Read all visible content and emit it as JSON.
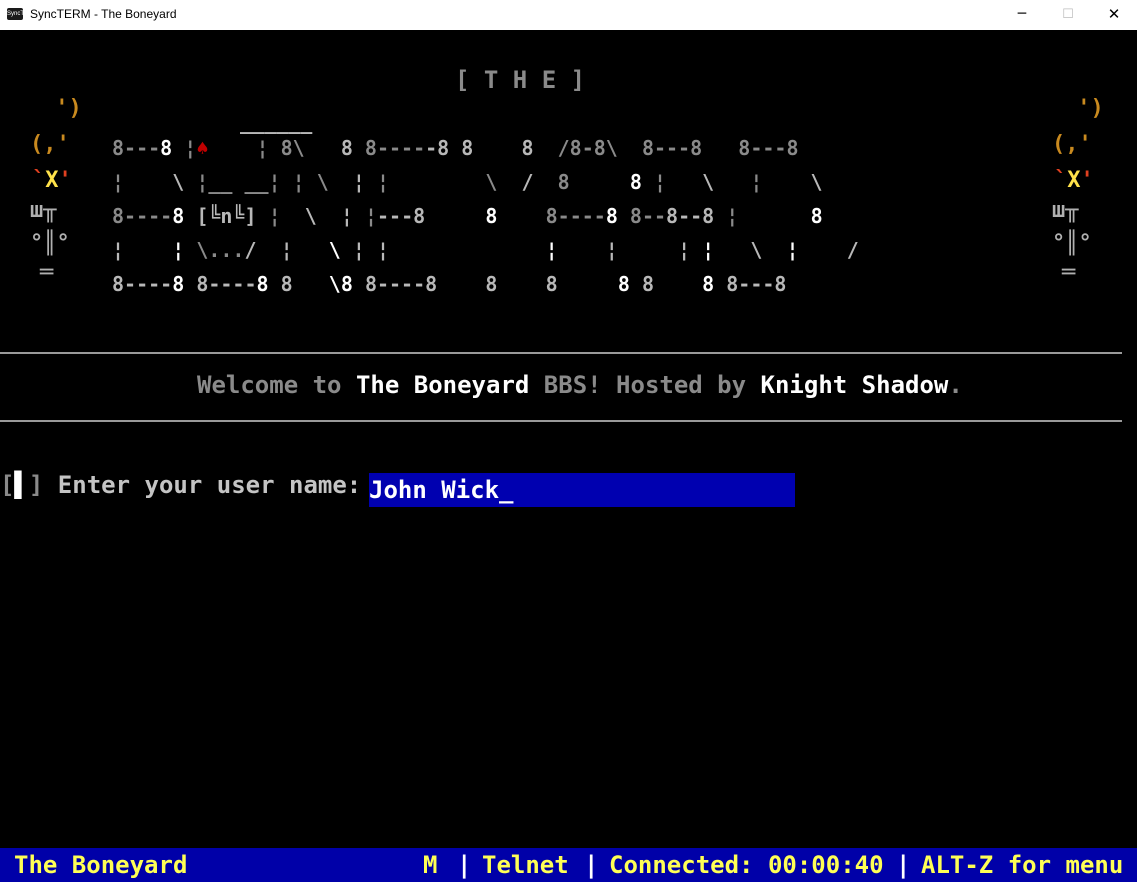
{
  "window": {
    "app_icon": "SyncTERM",
    "title": "SyncTERM - The Boneyard",
    "minimize_glyph": "─",
    "maximize_glyph": "☐",
    "close_glyph": "✕"
  },
  "banner": {
    "title": "[ T H E ]",
    "card_suit": "♠"
  },
  "welcome": {
    "part1": "Welcome to ",
    "board_name": "The Boneyard",
    "part2": " BBS! Hosted by ",
    "sysop": "Knight Shadow",
    "part3": "."
  },
  "login": {
    "bracket": "[",
    "marker": "▌",
    "bracket_close": "]",
    "prompt": " Enter your user name: ",
    "value": "John Wick",
    "cursor": "_"
  },
  "status": {
    "board": "The Boneyard",
    "mode": "M",
    "sep1": "|",
    "protocol": "Telnet",
    "sep2": "|",
    "connected": "Connected: 00:00:40",
    "sep3": "|",
    "menu_hint": "ALT-Z for menu"
  },
  "colors": {
    "status_bg": "#0000a8",
    "status_fg": "#ffff55",
    "input_bg": "#0000b0",
    "card_red": "#c00000"
  }
}
